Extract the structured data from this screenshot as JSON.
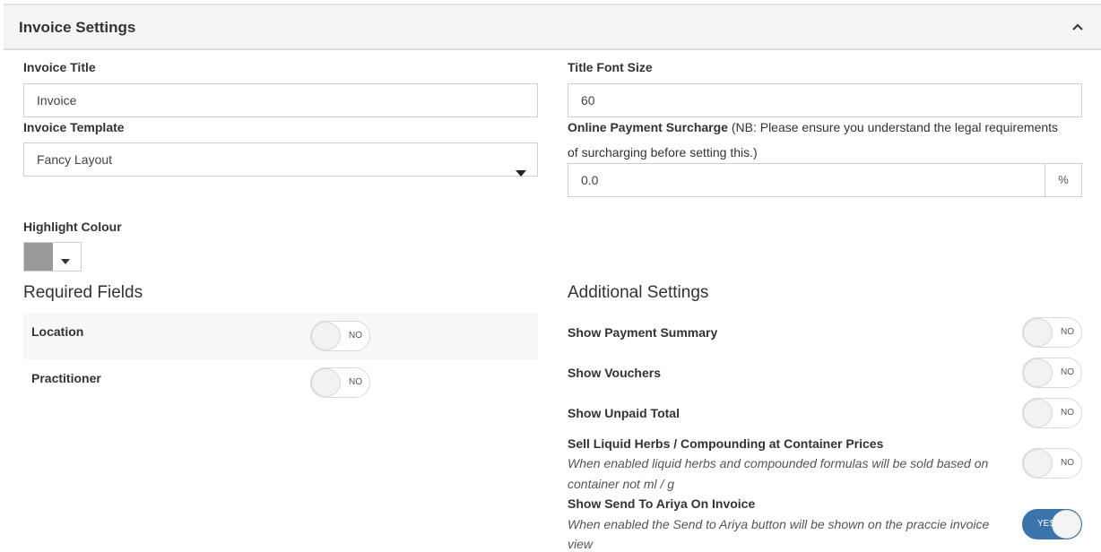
{
  "panel": {
    "title": "Invoice Settings"
  },
  "invoice_title": {
    "label": "Invoice Title",
    "value": "Invoice"
  },
  "title_font_size": {
    "label": "Title Font Size",
    "value": "60"
  },
  "invoice_template": {
    "label": "Invoice Template",
    "selected": "Fancy Layout"
  },
  "online_payment_surcharge": {
    "label": "Online Payment Surcharge",
    "note_line1": "(NB: Please ensure you understand the legal requirements",
    "note_line2": "of surcharging before setting this.)",
    "value": "0.0",
    "unit": "%"
  },
  "highlight_colour": {
    "label": "Highlight Colour",
    "value": "#9a9a9a"
  },
  "required_fields": {
    "heading": "Required Fields",
    "items": [
      {
        "label": "Location",
        "toggle": "NO"
      },
      {
        "label": "Practitioner",
        "toggle": "NO"
      }
    ]
  },
  "additional_settings": {
    "heading": "Additional Settings",
    "items": [
      {
        "label": "Show Payment Summary",
        "toggle": "NO"
      },
      {
        "label": "Show Vouchers",
        "toggle": "NO"
      },
      {
        "label": "Show Unpaid Total",
        "toggle": "NO"
      },
      {
        "label": "Sell Liquid Herbs / Compounding at Container Prices",
        "desc_line1": "When enabled liquid herbs and compounded formulas will be sold based on",
        "desc_line2": "container not ml / g",
        "toggle": "NO"
      },
      {
        "label": "Show Send To Ariya On Invoice",
        "desc_line1": "When enabled the Send to Ariya button will be shown on the praccie invoice",
        "desc_line2": "view",
        "toggle": "YES"
      }
    ]
  },
  "colors": {
    "toggle_on": "#3b73ab",
    "header_bg": "#f5f5f5"
  }
}
